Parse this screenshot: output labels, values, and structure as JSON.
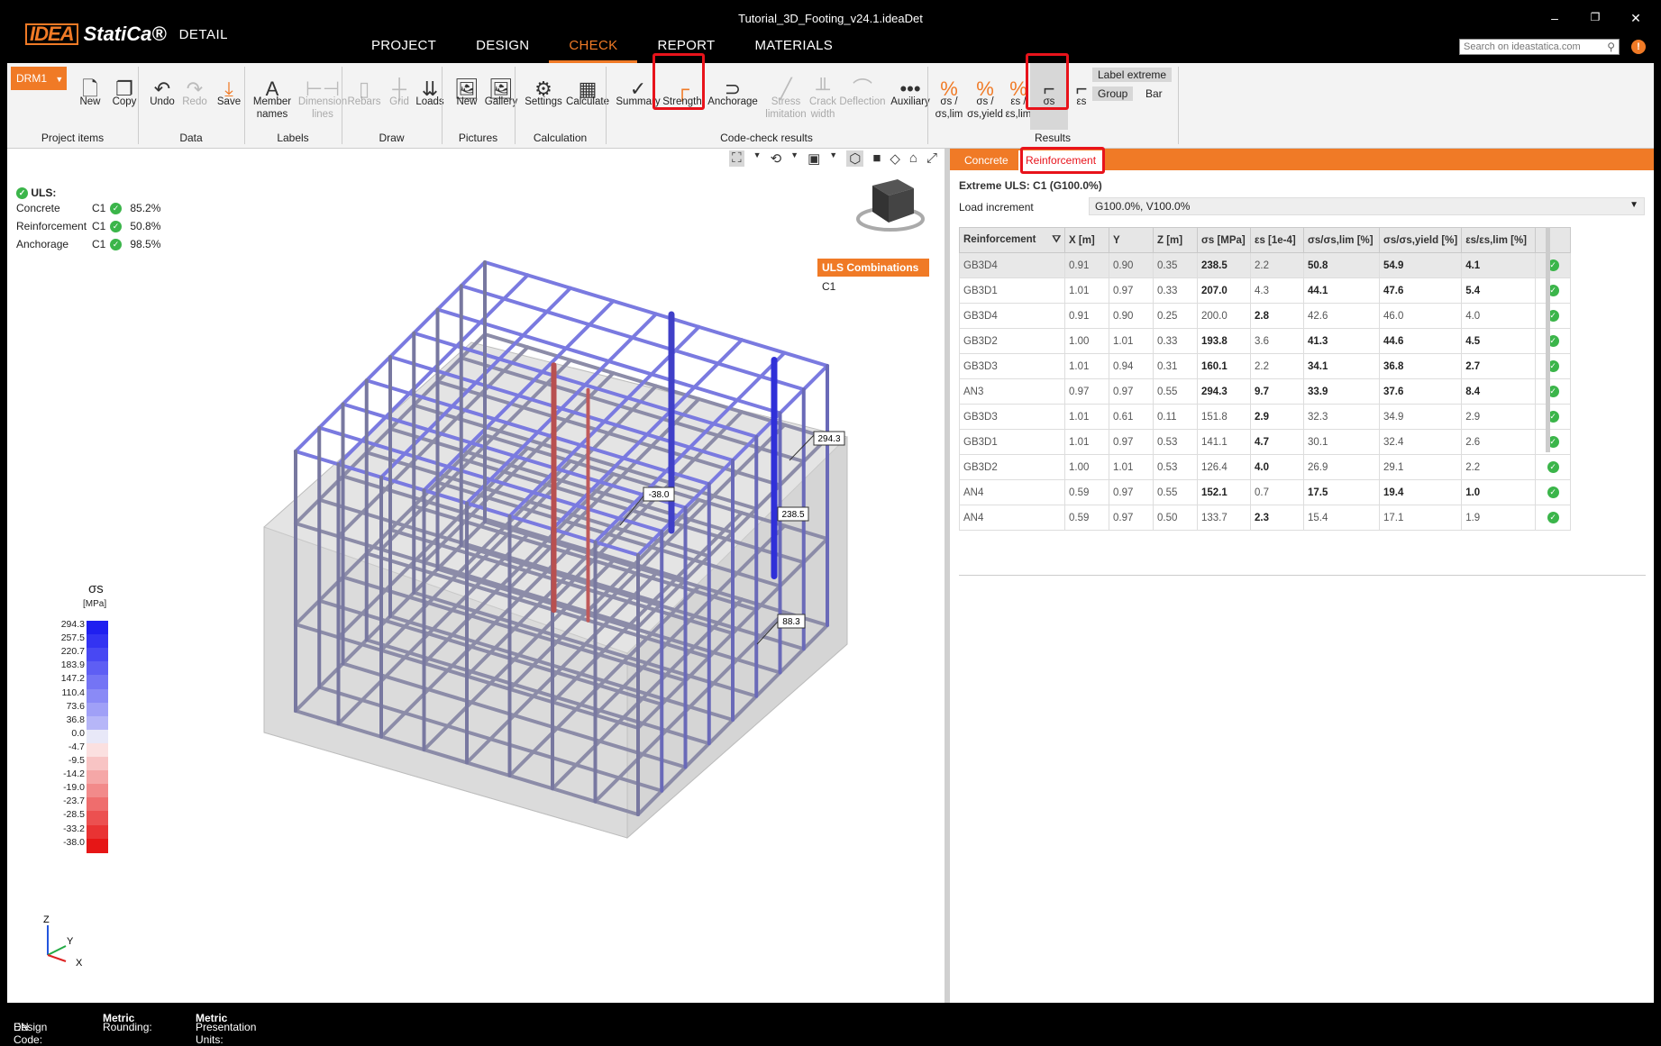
{
  "app": {
    "logo_mark": "IDEA",
    "logo_name": "StatiCa®",
    "logo_product": "DETAIL",
    "doc_title": "Tutorial_3D_Footing_v24.1.ideaDet",
    "win_min": "–",
    "win_max": "❐",
    "win_close": "✕"
  },
  "menu": [
    "PROJECT",
    "DESIGN",
    "CHECK",
    "REPORT",
    "MATERIALS"
  ],
  "search": {
    "placeholder": "Search on ideastatica.com"
  },
  "ribbon": {
    "drm": "DRM1",
    "buttons": {
      "new": "New",
      "copy": "Copy",
      "undo": "Undo",
      "redo": "Redo",
      "save": "Save",
      "member_names": "Member\nnames",
      "dimension_lines": "Dimension\nlines",
      "rebars": "Rebars",
      "grid": "Grid",
      "loads": "Loads",
      "pic_new": "New",
      "gallery": "Gallery",
      "settings": "Settings",
      "calculate": "Calculate",
      "summary": "Summary",
      "strength": "Strength",
      "anchorage": "Anchorage",
      "stress_limitation": "Stress\nlimitation",
      "crack_width": "Crack\nwidth",
      "deflection": "Deflection",
      "auxiliary": "Auxiliary",
      "sigma_lim": "σs /\nσs,lim",
      "sigma_yield": "σs /\nσs,yield",
      "eps_lim": "εs /\nεs,lim",
      "sigma_s": "σs",
      "eps_s": "εs",
      "label_extreme": "Label extreme",
      "group": "Group",
      "bar": "Bar"
    },
    "groups": {
      "project_items": "Project items",
      "data": "Data",
      "labels": "Labels",
      "draw": "Draw",
      "pictures": "Pictures",
      "calculation": "Calculation",
      "code_check": "Code-check results",
      "results": "Results"
    }
  },
  "uls": {
    "title": "ULS:",
    "rows": [
      {
        "name": "Concrete",
        "comb": "C1",
        "value": "85.2%"
      },
      {
        "name": "Reinforcement",
        "comb": "C1",
        "value": "50.8%"
      },
      {
        "name": "Anchorage",
        "comb": "C1",
        "value": "98.5%"
      }
    ]
  },
  "combinations": {
    "header": "ULS Combinations",
    "items": [
      "C1"
    ]
  },
  "legend": {
    "title": "σs",
    "unit": "[MPa]",
    "labels": [
      "294.3",
      "257.5",
      "220.7",
      "183.9",
      "147.2",
      "110.4",
      "73.6",
      "36.8",
      "0.0",
      "-4.7",
      "-9.5",
      "-14.2",
      "-19.0",
      "-23.7",
      "-28.5",
      "-33.2",
      "-38.0"
    ],
    "colors": [
      "#1f1ff0",
      "#3333f2",
      "#4848f3",
      "#5e5ef4",
      "#7474f5",
      "#8a8af6",
      "#a0a0f7",
      "#b6b6f8",
      "#e8e8f8",
      "#fbe0e0",
      "#f8c4c4",
      "#f5a7a7",
      "#f28a8a",
      "#ef6d6d",
      "#ec5050",
      "#e93333",
      "#e61616"
    ]
  },
  "view_labels": [
    "294.3",
    "-38.0",
    "238.5",
    "88.3"
  ],
  "axes": {
    "z": "Z",
    "y": "Y",
    "x": "X"
  },
  "right": {
    "tabs": [
      "Concrete",
      "Reinforcement"
    ],
    "extreme": "Extreme ULS: C1 (G100.0%)",
    "load_increment_label": "Load increment",
    "load_increment_value": "G100.0%, V100.0%",
    "table": {
      "headers": [
        "Reinforcement",
        "X [m]",
        "Y",
        "Z [m]",
        "σs [MPa]",
        "εs [1e-4]",
        "σs/σs,lim [%]",
        "σs/σs,yield [%]",
        "εs/εs,lim [%]",
        ""
      ],
      "rows": [
        [
          "GB3D4",
          "0.91",
          "0.90",
          "0.35",
          "238.5",
          "2.2",
          "50.8",
          "54.9",
          "4.1"
        ],
        [
          "GB3D1",
          "1.01",
          "0.97",
          "0.33",
          "207.0",
          "4.3",
          "44.1",
          "47.6",
          "5.4"
        ],
        [
          "GB3D4",
          "0.91",
          "0.90",
          "0.25",
          "200.0",
          "2.8",
          "42.6",
          "46.0",
          "4.0"
        ],
        [
          "GB3D2",
          "1.00",
          "1.01",
          "0.33",
          "193.8",
          "3.6",
          "41.3",
          "44.6",
          "4.5"
        ],
        [
          "GB3D3",
          "1.01",
          "0.94",
          "0.31",
          "160.1",
          "2.2",
          "34.1",
          "36.8",
          "2.7"
        ],
        [
          "AN3",
          "0.97",
          "0.97",
          "0.55",
          "294.3",
          "9.7",
          "33.9",
          "37.6",
          "8.4"
        ],
        [
          "GB3D3",
          "1.01",
          "0.61",
          "0.11",
          "151.8",
          "2.9",
          "32.3",
          "34.9",
          "2.9"
        ],
        [
          "GB3D1",
          "1.01",
          "0.97",
          "0.53",
          "141.1",
          "4.7",
          "30.1",
          "32.4",
          "2.6"
        ],
        [
          "GB3D2",
          "1.00",
          "1.01",
          "0.53",
          "126.4",
          "4.0",
          "26.9",
          "29.1",
          "2.2"
        ],
        [
          "AN4",
          "0.59",
          "0.97",
          "0.55",
          "152.1",
          "0.7",
          "17.5",
          "19.4",
          "1.0"
        ],
        [
          "AN4",
          "0.59",
          "0.97",
          "0.50",
          "133.7",
          "2.3",
          "15.4",
          "17.1",
          "1.9"
        ]
      ]
    }
  },
  "status": {
    "design_code_label": "Design Code:",
    "design_code": "EN",
    "rounding_label": "Rounding:",
    "rounding": "Metric",
    "units_label": "Presentation Units:",
    "units": "Metric"
  },
  "colors": {
    "accent": "#f07a26",
    "highlight": "#e8131b",
    "ok": "#3bb54a"
  }
}
